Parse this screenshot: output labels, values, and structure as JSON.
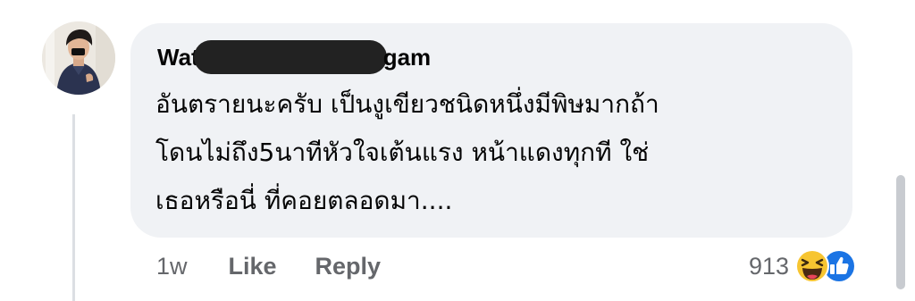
{
  "comment": {
    "author_visible_start": "Wat",
    "author_visible_end": "gam",
    "text_lines": [
      "อันตรายนะครับ เป็นงูเขียวชนิดหนึ่งมีพิษมากถ้า",
      "โดนไม่ถึง5นาทีหัวใจเต้นแรง หน้าแดงทุกที ใช่",
      "เธอหรือนี่ ที่คอยตลอดมา...."
    ],
    "timestamp": "1w",
    "like_label": "Like",
    "reply_label": "Reply",
    "reaction_count": "913",
    "reaction_icons": [
      "haha-icon",
      "like-icon"
    ]
  },
  "colors": {
    "bubble_bg": "#f0f2f5",
    "text_primary": "#050505",
    "text_secondary": "#65676b",
    "like_blue": "#1b74e4",
    "haha_yellow": "#f7c531",
    "redaction": "#222222"
  }
}
